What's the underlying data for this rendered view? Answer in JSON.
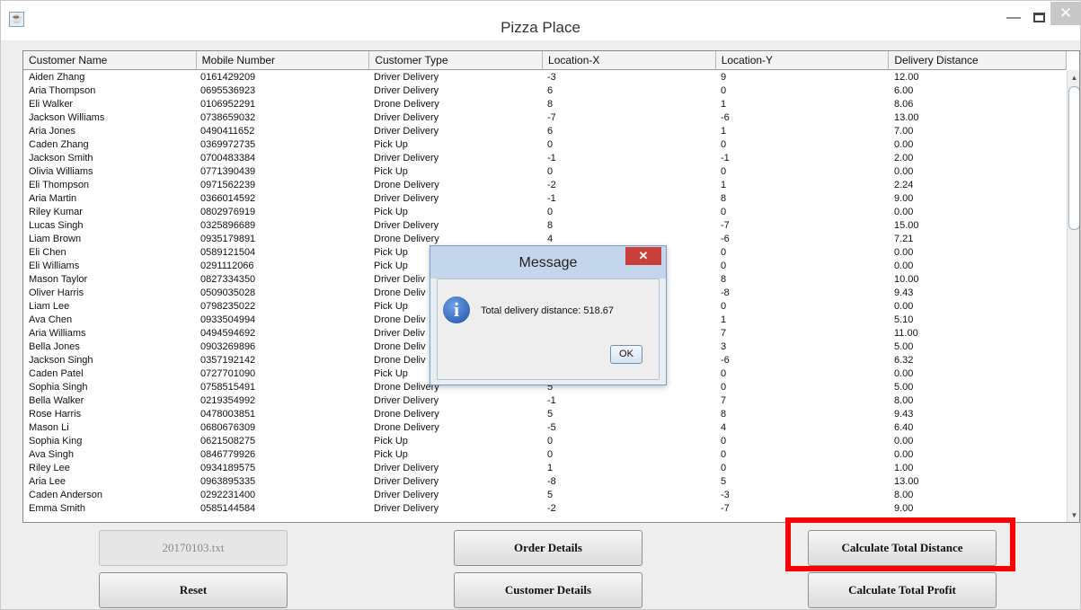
{
  "window": {
    "title": "Pizza Place"
  },
  "table": {
    "columns": [
      "Customer Name",
      "Mobile Number",
      "Customer Type",
      "Location-X",
      "Location-Y",
      "Delivery Distance"
    ],
    "rows": [
      [
        "Aiden Zhang",
        "0161429209",
        "Driver Delivery",
        "-3",
        "9",
        "12.00"
      ],
      [
        "Aria Thompson",
        "0695536923",
        "Driver Delivery",
        "6",
        "0",
        "6.00"
      ],
      [
        "Eli Walker",
        "0106952291",
        "Drone Delivery",
        "8",
        "1",
        "8.06"
      ],
      [
        "Jackson Williams",
        "0738659032",
        "Driver Delivery",
        "-7",
        "-6",
        "13.00"
      ],
      [
        "Aria Jones",
        "0490411652",
        "Driver Delivery",
        "6",
        "1",
        "7.00"
      ],
      [
        "Caden Zhang",
        "0369972735",
        "Pick Up",
        "0",
        "0",
        "0.00"
      ],
      [
        "Jackson Smith",
        "0700483384",
        "Driver Delivery",
        "-1",
        "-1",
        "2.00"
      ],
      [
        "Olivia Williams",
        "0771390439",
        "Pick Up",
        "0",
        "0",
        "0.00"
      ],
      [
        "Eli Thompson",
        "0971562239",
        "Drone Delivery",
        "-2",
        "1",
        "2.24"
      ],
      [
        "Aria Martin",
        "0366014592",
        "Driver Delivery",
        "-1",
        "8",
        "9.00"
      ],
      [
        "Riley Kumar",
        "0802976919",
        "Pick Up",
        "0",
        "0",
        "0.00"
      ],
      [
        "Lucas Singh",
        "0325896689",
        "Driver Delivery",
        "8",
        "-7",
        "15.00"
      ],
      [
        "Liam Brown",
        "0935179891",
        "Drone Delivery",
        "4",
        "-6",
        "7.21"
      ],
      [
        "Eli Chen",
        "0589121504",
        "Pick Up",
        "",
        "0",
        "0.00"
      ],
      [
        "Eli Williams",
        "0291112066",
        "Pick Up",
        "",
        "0",
        "0.00"
      ],
      [
        "Mason Taylor",
        "0827334350",
        "Driver Deliv",
        "",
        "8",
        "10.00"
      ],
      [
        "Oliver Harris",
        "0509035028",
        "Drone Deliv",
        "",
        "-8",
        "9.43"
      ],
      [
        "Liam Lee",
        "0798235022",
        "Pick Up",
        "",
        "0",
        "0.00"
      ],
      [
        "Ava Chen",
        "0933504994",
        "Drone Deliv",
        "",
        "1",
        "5.10"
      ],
      [
        "Aria Williams",
        "0494594692",
        "Driver Deliv",
        "",
        "7",
        "11.00"
      ],
      [
        "Bella Jones",
        "0903269896",
        "Drone Deliv",
        "",
        "3",
        "5.00"
      ],
      [
        "Jackson Singh",
        "0357192142",
        "Drone Deliv",
        "",
        "-6",
        "6.32"
      ],
      [
        "Caden Patel",
        "0727701090",
        "Pick Up",
        "",
        "0",
        "0.00"
      ],
      [
        "Sophia Singh",
        "0758515491",
        "Drone Delivery",
        "5",
        "0",
        "5.00"
      ],
      [
        "Bella Walker",
        "0219354992",
        "Driver Delivery",
        "-1",
        "7",
        "8.00"
      ],
      [
        "Rose Harris",
        "0478003851",
        "Drone Delivery",
        "5",
        "8",
        "9.43"
      ],
      [
        "Mason Li",
        "0680676309",
        "Drone Delivery",
        "-5",
        "4",
        "6.40"
      ],
      [
        "Sophia King",
        "0621508275",
        "Pick Up",
        "0",
        "0",
        "0.00"
      ],
      [
        "Ava Singh",
        "0846779926",
        "Pick Up",
        "0",
        "0",
        "0.00"
      ],
      [
        "Riley Lee",
        "0934189575",
        "Driver Delivery",
        "1",
        "0",
        "1.00"
      ],
      [
        "Aria Lee",
        "0963895335",
        "Driver Delivery",
        "-8",
        "5",
        "13.00"
      ],
      [
        "Caden Anderson",
        "0292231400",
        "Driver Delivery",
        "5",
        "-3",
        "8.00"
      ],
      [
        "Emma Smith",
        "0585144584",
        "Driver Delivery",
        "-2",
        "-7",
        "9.00"
      ]
    ]
  },
  "buttons": {
    "file": "20170103.txt",
    "order_details": "Order Details",
    "calc_distance": "Calculate Total Distance",
    "reset": "Reset",
    "customer_details": "Customer Details",
    "calc_profit": "Calculate Total Profit"
  },
  "dialog": {
    "title": "Message",
    "message": "Total delivery distance: 518.67",
    "ok": "OK"
  }
}
